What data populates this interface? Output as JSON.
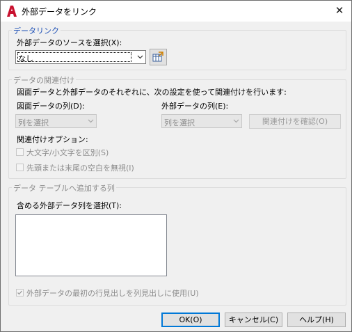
{
  "window": {
    "title": "外部データをリンク",
    "close_glyph": "✕",
    "icon": "autocad-a-icon"
  },
  "data_link": {
    "legend": "データリンク",
    "source_label": "外部データのソースを選択(X):",
    "source_value": "なし",
    "launch_manager_icon": "data-link-manager-icon"
  },
  "matching": {
    "legend": "データの関連付け",
    "description": "図面データと外部データのそれぞれに、次の設定を使って関連付けを行います:",
    "drawing_column_label": "図面データの列(D):",
    "drawing_column_value": "列を選択",
    "external_column_label": "外部データの列(E):",
    "external_column_value": "列を選択",
    "verify_button": "関連付けを確認(O)",
    "options_label": "関連付けオプション:",
    "case_sensitive": "大文字/小文字を区別(S)",
    "ignore_whitespace": "先頭または末尾の空白を無視(I)"
  },
  "add_columns": {
    "legend": "データ テーブルへ追加する列",
    "include_label": "含める外部データ列を選択(T):",
    "use_header_label": "外部データの最初の行見出しを列見出しに使用(U)",
    "use_header_checked": true
  },
  "buttons": {
    "ok": "OK(O)",
    "cancel": "キャンセル(C)",
    "help": "ヘルプ(H)"
  },
  "colors": {
    "accent": "#1c4fb5",
    "brand_red": "#c8102e",
    "dialog_bg": "#f0f0f0"
  }
}
